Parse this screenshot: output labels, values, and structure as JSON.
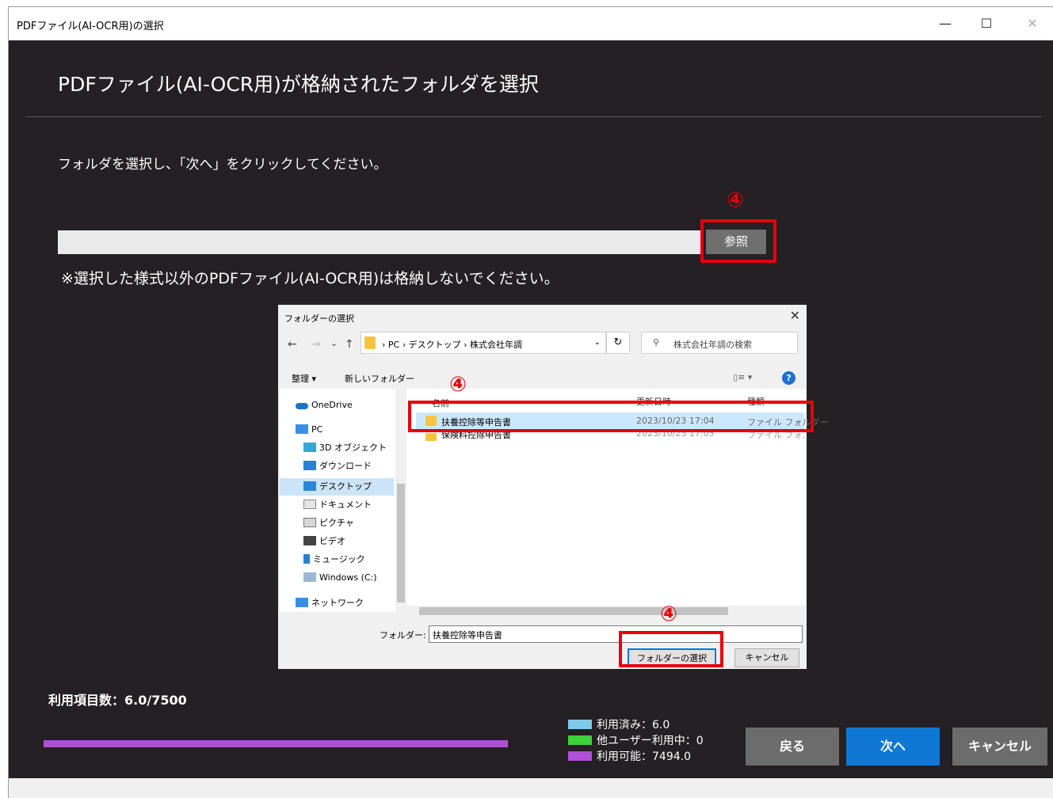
{
  "window": {
    "title": "PDFファイル(AI-OCR用)の選択",
    "minimize": "—",
    "maximize": "☐",
    "close": "✕"
  },
  "main": {
    "heading": "PDFファイル(AI-OCR用)が格納されたフォルダを選択",
    "instruction": "フォルダを選択し、「次へ」をクリックしてください。",
    "path_value": "",
    "browse_label": "参照",
    "note": "※選択した様式以外のPDFファイル(AI-OCR用)は格納しないでください。",
    "step_marker": "④"
  },
  "dialog": {
    "title": "フォルダーの選択",
    "close": "✕",
    "nav_back": "←",
    "nav_forward": "→",
    "nav_recent": "⌄",
    "nav_up": "↑",
    "breadcrumb": "› PC › デスクトップ › 株式会社年調",
    "address_dropdown": "⌄",
    "refresh": "↻",
    "search_icon": "⚲",
    "search_placeholder": "株式会社年調の検索",
    "organize": "整理 ▾",
    "new_folder": "新しいフォルダー",
    "view_toggle": "▯≡ ▾",
    "help": "?",
    "nav_items": [
      "OneDrive",
      "PC",
      "3D オブジェクト",
      "ダウンロード",
      "デスクトップ",
      "ドキュメント",
      "ピクチャ",
      "ビデオ",
      "ミュージック",
      "Windows (C:)",
      "ネットワーク"
    ],
    "columns": {
      "name": "名前",
      "modified": "更新日時",
      "type": "種類"
    },
    "rows": [
      {
        "name": "扶養控除等申告書",
        "modified": "2023/10/23 17:04",
        "type": "ファイル フォルダー"
      },
      {
        "name": "保険料控除申告書",
        "modified": "2023/10/23 17:05",
        "type": "ファイル フォルダー"
      }
    ],
    "folder_label": "フォルダー:",
    "folder_value": "扶養控除等申告書",
    "select_button": "フォルダーの選択",
    "cancel_button": "キャンセル"
  },
  "usage": {
    "label": "利用項目数：6.0/7500",
    "legend": [
      {
        "label": "利用済み：6.0",
        "color": "#7fc9e8"
      },
      {
        "label": "他ユーザー利用中：0",
        "color": "#3bd13b"
      },
      {
        "label": "利用可能：7494.0",
        "color": "#b14fd6"
      }
    ]
  },
  "buttons": {
    "back": "戻る",
    "next": "次へ",
    "cancel": "キャンセル"
  }
}
